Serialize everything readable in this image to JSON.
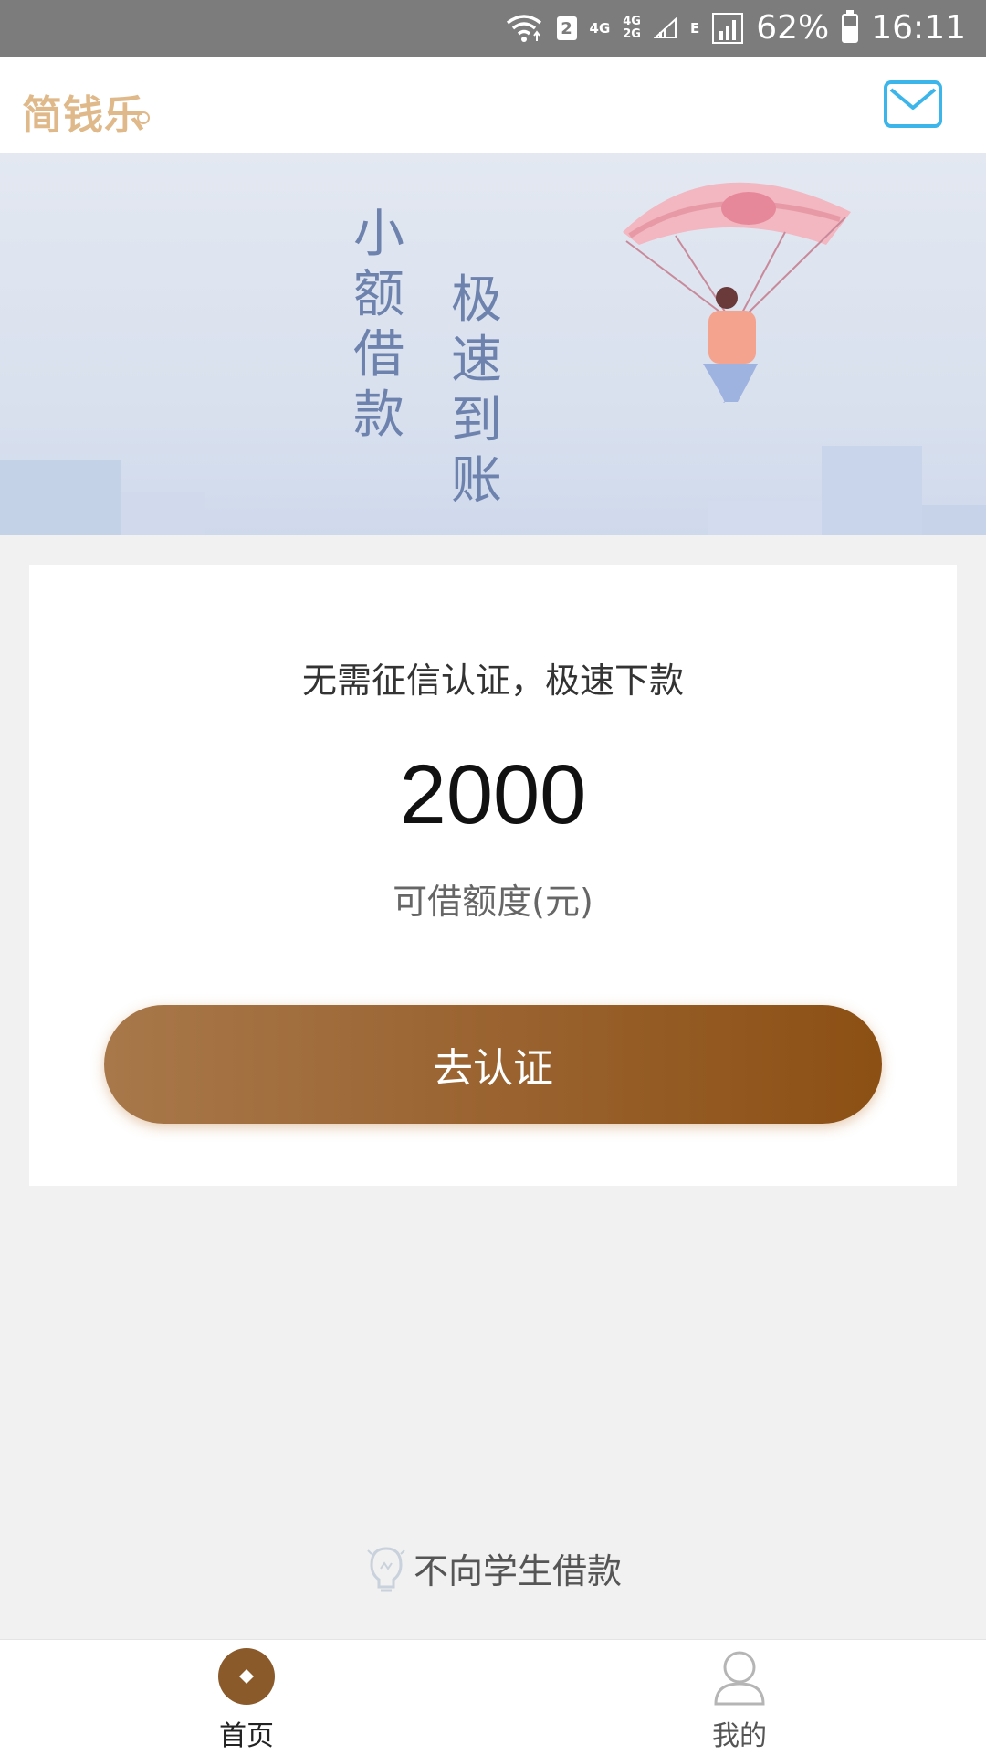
{
  "status_bar": {
    "sim_number": "2",
    "net_a": "4G",
    "net_b_top": "4G",
    "net_b_bottom": "2G",
    "net_c": "E",
    "battery_percent": "62%",
    "battery_level": 0.62,
    "time": "16:11",
    "icons": [
      "wifi-icon",
      "sim-icon",
      "signal-icon",
      "battery-icon"
    ]
  },
  "header": {
    "logo": "简钱乐",
    "mail_icon": "mail-icon"
  },
  "banner": {
    "column_left": [
      "小",
      "额",
      "借",
      "款"
    ],
    "column_right": [
      "极",
      "速",
      "到",
      "账"
    ]
  },
  "card": {
    "tagline": "无需征信认证，极速下款",
    "amount": "2000",
    "amount_label": "可借额度(元)",
    "button_label": "去认证"
  },
  "notice": {
    "icon": "lightbulb-icon",
    "text": "不向学生借款"
  },
  "bottom_nav": {
    "items": [
      {
        "label": "首页",
        "icon": "home-coin-icon",
        "active": true
      },
      {
        "label": "我的",
        "icon": "user-icon",
        "active": false
      }
    ]
  },
  "colors": {
    "accent_brown": "#9a6330",
    "logo": "#e0b98a",
    "mail_blue": "#3cb6ea",
    "banner_text": "#6e82ae"
  }
}
